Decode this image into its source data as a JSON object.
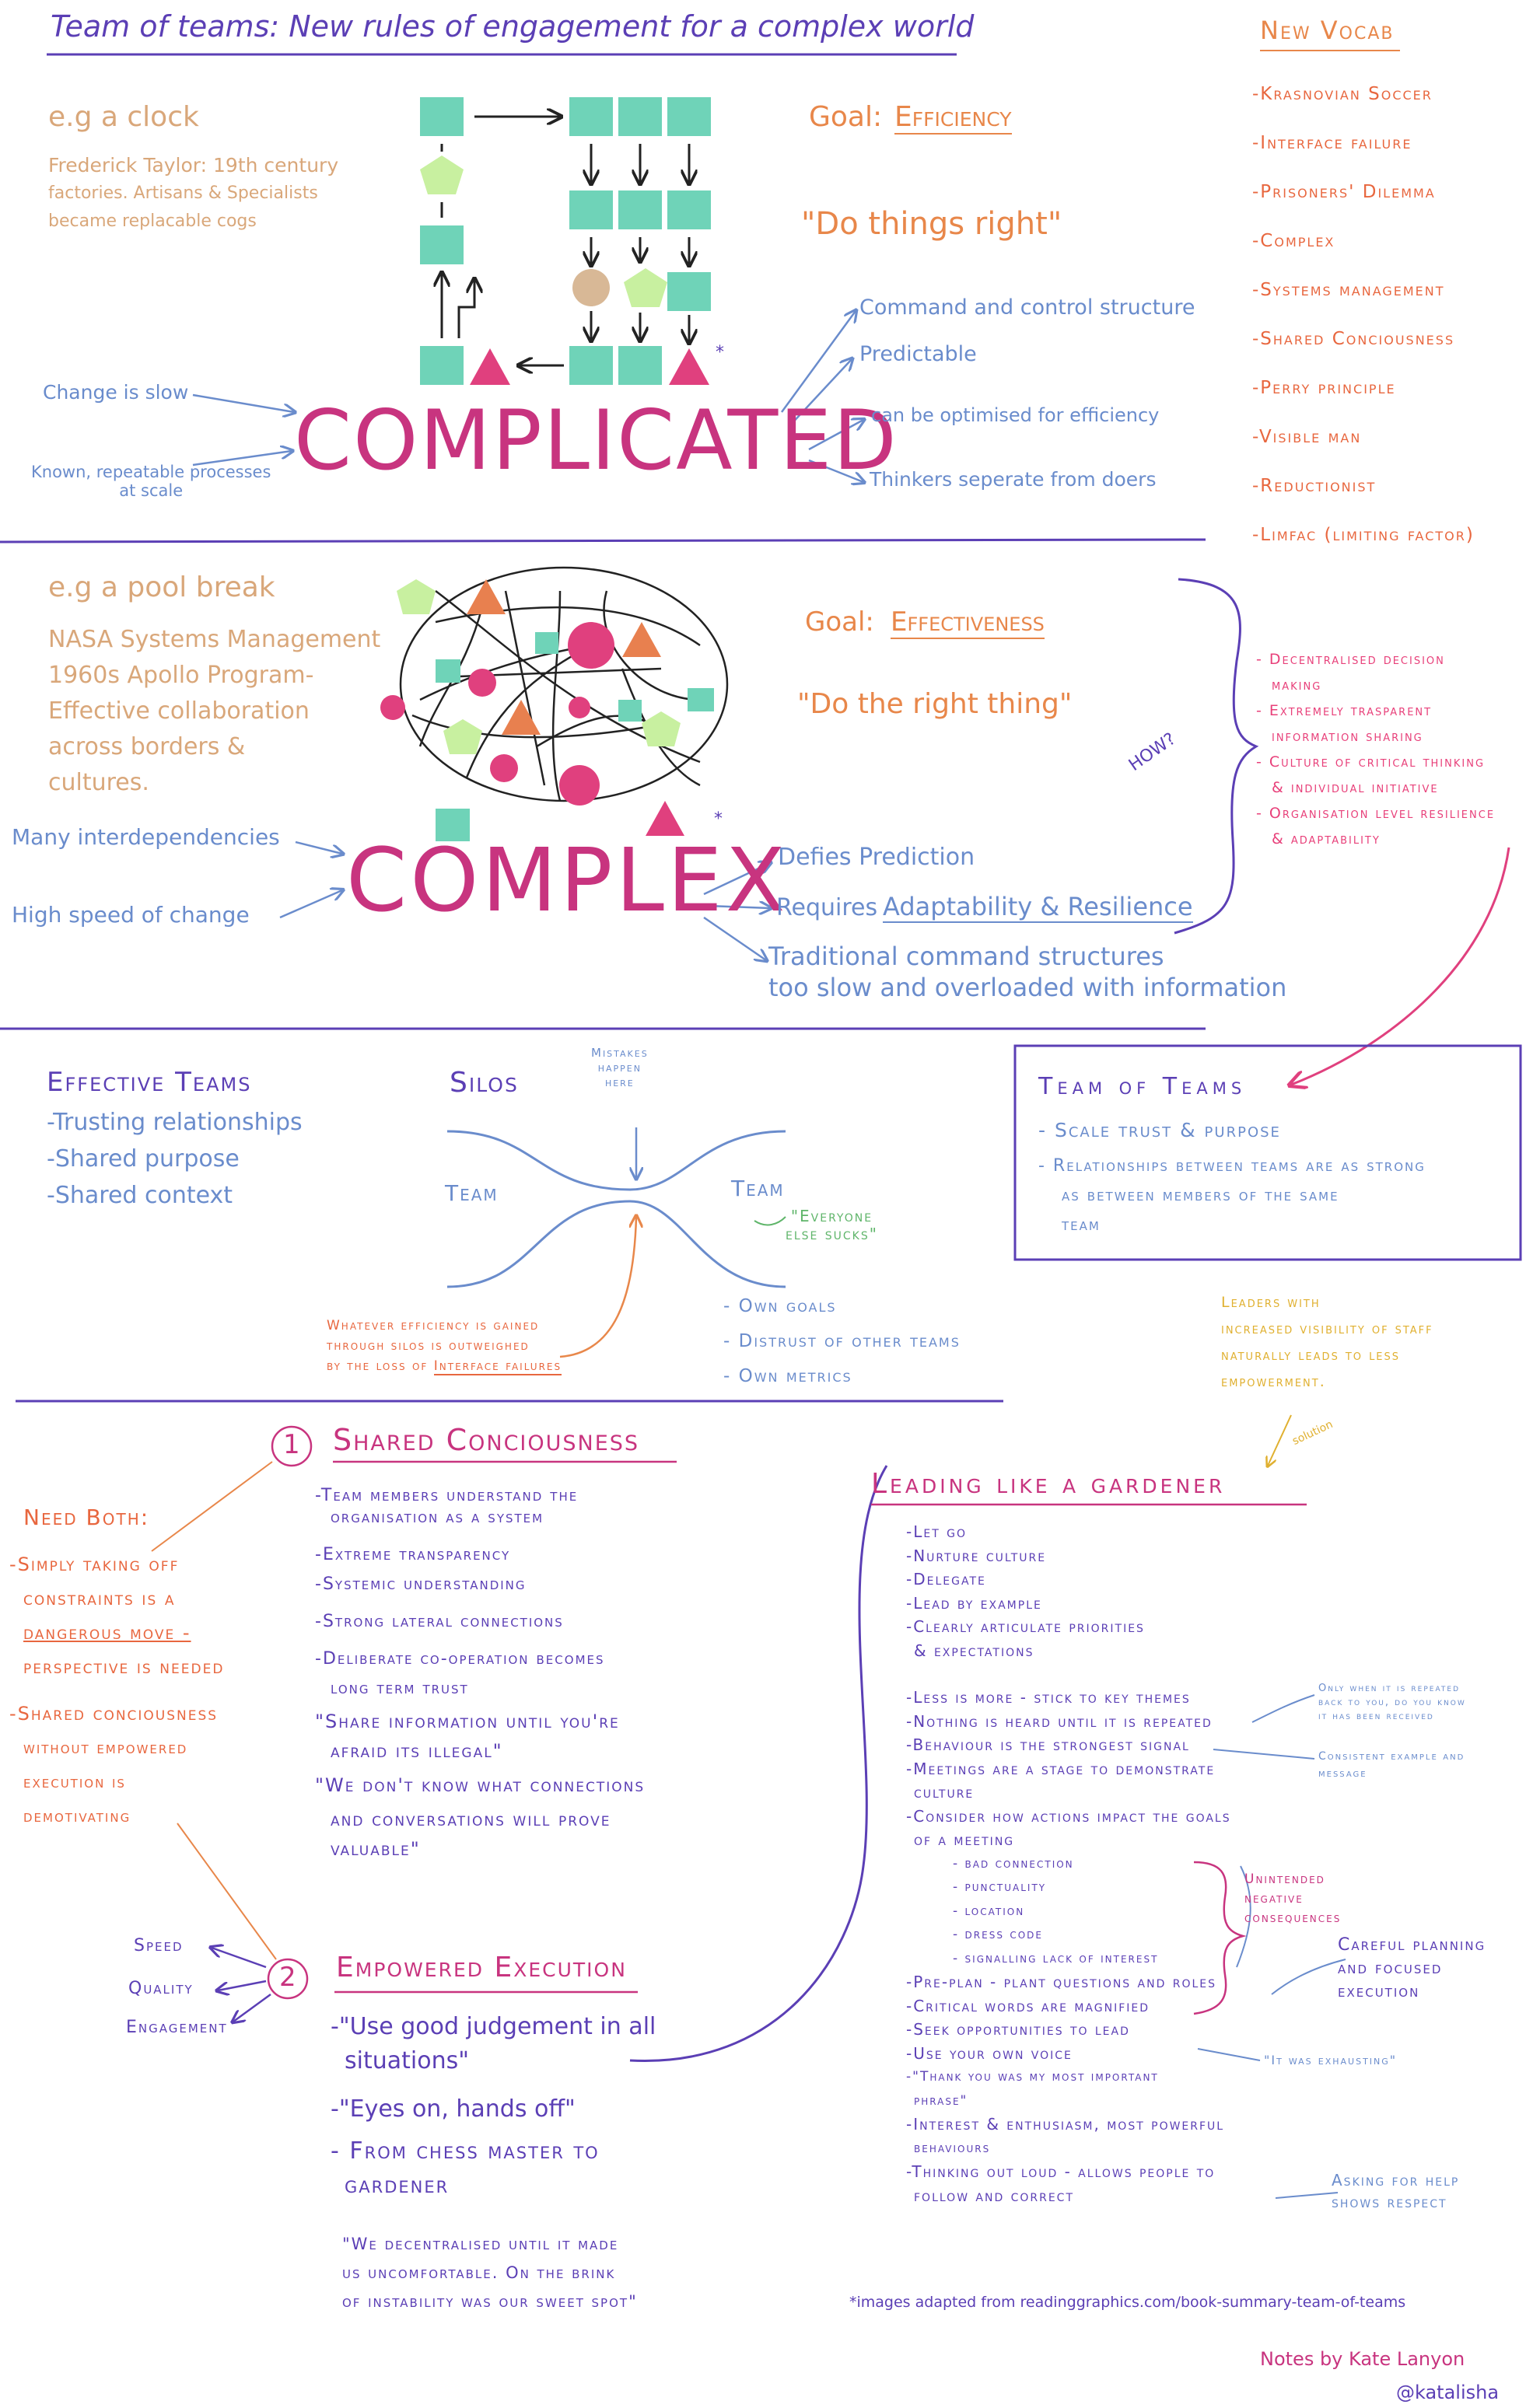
{
  "colors": {
    "purple": "#5b3fb5",
    "blue": "#6a8ccc",
    "tan": "#d9a77a",
    "orange": "#e8874a",
    "coral": "#e8673f",
    "magenta": "#c8347f",
    "pink": "#e0407e",
    "teal": "#6fd3b8",
    "lime": "#c8f0a0",
    "gold": "#e0b030",
    "red": "#e84a6a",
    "salmon": "#e8804f"
  },
  "title": "Team of teams: New rules of engagement for a complex world",
  "vocab": {
    "heading": "New Vocab",
    "items": [
      "-Krasnovian Soccer",
      "-Interface failure",
      "-Prisoners' Dilemma",
      "-Complex",
      "-Systems management",
      "-Shared Conciousness",
      "-Perry principle",
      "-Visible man",
      "-Reductionist",
      "-Limfac (limiting factor)"
    ]
  },
  "complicated": {
    "example": "e.g a clock",
    "desc": [
      "Frederick Taylor: 19th century",
      "factories. Artisans & Specialists",
      "became replacable cogs"
    ],
    "goal_label": "Goal:",
    "goal_value": "Efficiency",
    "quote": "\"Do things right\"",
    "word": "COMPLICATED",
    "inputs": [
      "Change is slow",
      "Known, repeatable processes",
      "at scale"
    ],
    "outputs": [
      "Command and control structure",
      "Predictable",
      "can be optimised for efficiency",
      "Thinkers seperate from doers"
    ]
  },
  "complex": {
    "example": "e.g a pool break",
    "desc": [
      "NASA Systems Management",
      "1960s Apollo Program-",
      "Effective collaboration",
      "across borders &",
      "cultures."
    ],
    "goal_label": "Goal:",
    "goal_value": "Effectiveness",
    "quote": "\"Do the right thing\"",
    "word": "COMPLEX",
    "inputs": [
      "Many interdependencies",
      "High speed of change"
    ],
    "outputs_prefix": [
      "Defies Prediction",
      "Requires"
    ],
    "outputs_emph": "Adaptability & Resilience",
    "outputs_last": [
      "Traditional command structures",
      "too slow and overloaded with information"
    ],
    "how": "HOW?",
    "how_items": [
      "- Decentralised decision",
      "making",
      "- Extremely trasparent",
      "information sharing",
      "- Culture of critical thinking",
      "& individual initiative",
      "- Organisation level resilience",
      "& adaptability"
    ]
  },
  "teams": {
    "effective_heading": "Effective Teams",
    "effective_items": [
      "-Trusting relationships",
      "-Shared purpose",
      "-Shared context"
    ],
    "silos_label": "Silos",
    "mistakes": [
      "Mistakes",
      "happen",
      "here"
    ],
    "team_left": "Team",
    "team_right": "Team",
    "everyone": [
      "\"Everyone",
      "else sucks\""
    ],
    "silo_props": [
      "- Own goals",
      "- Distrust of other teams",
      "- Own metrics"
    ],
    "efficiency_note": [
      "Whatever efficiency is gained",
      "through silos is outweighed",
      "by the loss of"
    ],
    "interface_failures": "Interface failures",
    "tot_heading": "Team of Teams",
    "tot_items": [
      "- Scale trust & purpose",
      "- Relationships between teams are as strong",
      "as between members of the same",
      "team"
    ],
    "leaders_note": [
      "Leaders with",
      "increased visibility of staff",
      "naturally leads to less",
      "empowerment."
    ],
    "solution": "solution"
  },
  "shared": {
    "number": "1",
    "heading": "Shared Conciousness",
    "items": [
      "-Team members understand the",
      "organisation as a system",
      "-Extreme transparency",
      "-Systemic understanding",
      "-Strong lateral connections",
      "-Deliberate co-operation becomes",
      "long term trust",
      "\"Share information until you're",
      "afraid its illegal\"",
      "\"We don't know what connections",
      "and conversations will prove",
      "valuable\""
    ]
  },
  "need_both": {
    "heading": "Need Both:",
    "items": [
      "-Simply taking off",
      "constraints is a",
      "dangerous move -",
      "perspective is needed",
      "-Shared conciousness",
      "without empowered",
      "execution is",
      "demotivating"
    ]
  },
  "empowered": {
    "number": "2",
    "heading": "Empowered Execution",
    "outcomes": [
      "Speed",
      "Quality",
      "Engagement"
    ],
    "items": [
      "-\"Use good judgement in all",
      "situations\"",
      "-\"Eyes on, hands off\"",
      "- From chess master to",
      "gardener"
    ],
    "quote": [
      "\"We decentralised until it made",
      "us uncomfortable. On the brink",
      "of instability was our sweet spot\""
    ]
  },
  "gardener": {
    "heading": "Leading like a gardener",
    "items": [
      "-Let go",
      "-Nurture culture",
      "-Delegate",
      "-Lead by example",
      "-Clearly articulate priorities",
      "& expectations",
      "",
      "-Less is more - stick to key themes",
      "-Nothing is heard until it is repeated",
      "-Behaviour is the strongest signal",
      "-Meetings are a stage to demonstrate",
      "culture",
      "-Consider how actions impact the goals",
      "of a meeting",
      "- bad connection",
      "- punctuality",
      "- location",
      "- dress code",
      "- signalling lack of interest",
      "-Pre-plan - plant questions and roles",
      "-Critical words are magnified",
      "-Seek opportunities to lead",
      "-Use your own voice",
      "-\"Thank you was my most important",
      "phrase\"",
      "-Interest & enthusiasm, most powerful",
      "behaviours",
      "-Thinking out loud - allows people to",
      "follow and correct"
    ],
    "note_repeat": [
      "Only when it is repeated",
      "back to you, do you know",
      "it has been received"
    ],
    "note_consistent": [
      "Consistent example and",
      "message"
    ],
    "note_unintended": [
      "Unintended",
      "negative",
      "consequences"
    ],
    "note_careful": [
      "Careful planning",
      "and focused",
      "execution"
    ],
    "note_exhausting": "\"It was exhausting\"",
    "note_asking": [
      "Asking for help",
      "shows respect"
    ]
  },
  "credit": "*images adapted from readinggraphics.com/book-summary-team-of-teams",
  "author": "Notes by Kate Lanyon",
  "handle": "@katalisha"
}
